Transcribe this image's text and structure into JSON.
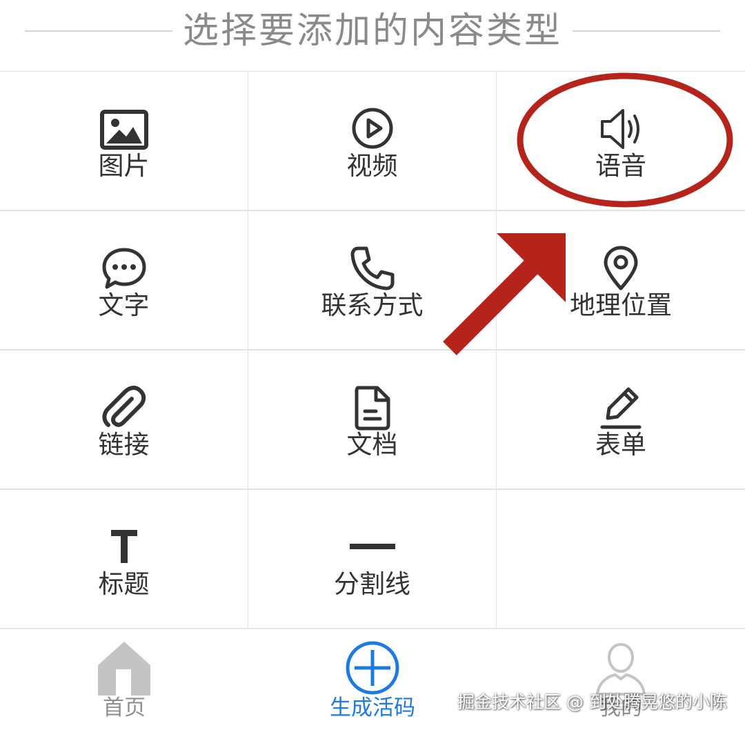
{
  "header": {
    "title": "选择要添加的内容类型"
  },
  "grid": {
    "items": [
      {
        "label": "图片",
        "icon": "image-icon"
      },
      {
        "label": "视频",
        "icon": "video-play-icon"
      },
      {
        "label": "语音",
        "icon": "speaker-icon"
      },
      {
        "label": "文字",
        "icon": "chat-bubble-icon"
      },
      {
        "label": "联系方式",
        "icon": "phone-icon"
      },
      {
        "label": "地理位置",
        "icon": "map-pin-icon"
      },
      {
        "label": "链接",
        "icon": "paperclip-icon"
      },
      {
        "label": "文档",
        "icon": "document-icon"
      },
      {
        "label": "表单",
        "icon": "pencil-icon"
      },
      {
        "label": "标题",
        "icon": "title-t-icon"
      },
      {
        "label": "分割线",
        "icon": "divider-line-icon"
      }
    ]
  },
  "nav": {
    "items": [
      {
        "label": "首页",
        "icon": "home-icon",
        "active": false
      },
      {
        "label": "生成活码",
        "icon": "plus-circle-icon",
        "active": true
      },
      {
        "label": "我的",
        "icon": "user-icon",
        "active": false
      }
    ]
  },
  "annotations": {
    "highlight_color": "#b5231b"
  },
  "watermark": {
    "text": "掘金技术社区 @ 到处腾晃悠的小陈"
  },
  "colors": {
    "accent": "#1b7be0",
    "icon": "#333333",
    "nav_inactive": "#c4c4c4"
  }
}
